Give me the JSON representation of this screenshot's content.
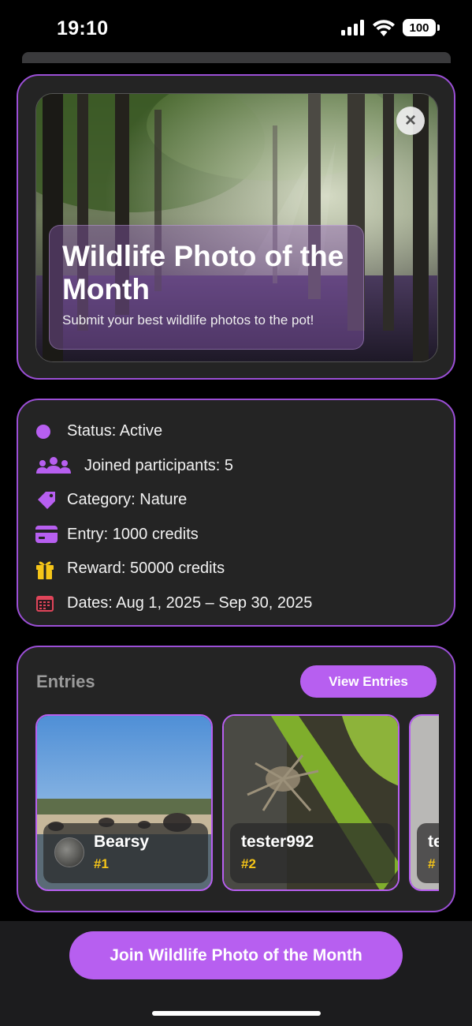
{
  "status_bar": {
    "time": "19:10",
    "battery": "100"
  },
  "hero": {
    "title": "Wildlife Photo of the Month",
    "subtitle": "Submit your best wildlife photos to the pot!",
    "close_icon": "close-icon"
  },
  "info": {
    "status": "Status: Active",
    "participants": "Joined participants: 5",
    "category": "Category: Nature",
    "entry": "Entry: 1000 credits",
    "reward": "Reward: 50000 credits",
    "dates": "Dates: Aug 1, 2025 – Sep 30, 2025"
  },
  "entries": {
    "title": "Entries",
    "view_button": "View Entries",
    "items": [
      {
        "name": "Bearsy",
        "rank": "#1"
      },
      {
        "name": "tester992",
        "rank": "#2"
      },
      {
        "name": "te",
        "rank": "#"
      }
    ]
  },
  "footer": {
    "join_button": "Join Wildlife Photo of the Month"
  },
  "colors": {
    "accent": "#b75ff0",
    "border": "#9b4fd6",
    "card_bg": "#242424",
    "rank": "#f5c518"
  }
}
